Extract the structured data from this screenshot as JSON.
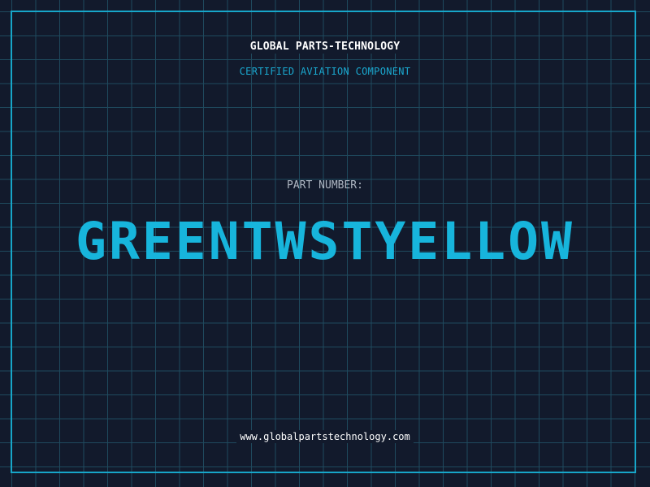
{
  "header": {
    "company": "GLOBAL PARTS-TECHNOLOGY",
    "tagline": "CERTIFIED AVIATION COMPONENT"
  },
  "part": {
    "label": "PART NUMBER:",
    "number": "GREENTWSTYELLOW"
  },
  "footer": {
    "website": "www.globalpartstechnology.com"
  },
  "colors": {
    "background": "#121a2c",
    "grid": "#1f4a5e",
    "accent": "#17b5dc",
    "text": "#ffffff"
  }
}
